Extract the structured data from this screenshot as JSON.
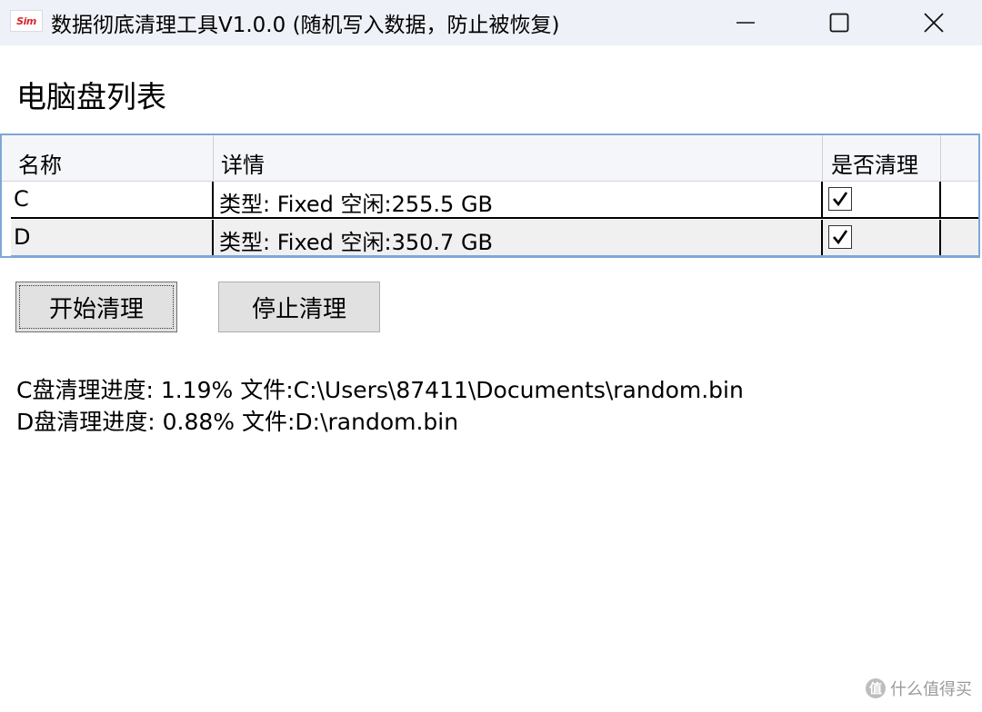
{
  "window": {
    "logo_text": "Sim",
    "title": "数据彻底清理工具V1.0.0 (随机写入数据，防止被恢复)",
    "minimize_icon": "minimize-icon",
    "maximize_icon": "maximize-icon",
    "close_icon": "close-icon"
  },
  "section": {
    "title": "电脑盘列表"
  },
  "table": {
    "columns": {
      "name": "名称",
      "detail": "详情",
      "clean": "是否清理"
    },
    "rows": [
      {
        "name": "C",
        "detail": "类型: Fixed 空闲:255.5 GB",
        "clean": true
      },
      {
        "name": "D",
        "detail": "类型: Fixed 空闲:350.7 GB",
        "clean": true
      }
    ]
  },
  "buttons": {
    "start": "开始清理",
    "stop": "停止清理"
  },
  "progress": {
    "c": "C盘清理进度: 1.19% 文件:C:\\Users\\87411\\Documents\\random.bin",
    "d": "D盘清理进度: 0.88% 文件:D:\\random.bin"
  },
  "watermark": {
    "badge": "值",
    "text": "什么值得买"
  },
  "colors": {
    "titlebar_bg": "#eef1f7",
    "table_border": "#7fa6d6",
    "button_bg": "#e1e1e1"
  }
}
